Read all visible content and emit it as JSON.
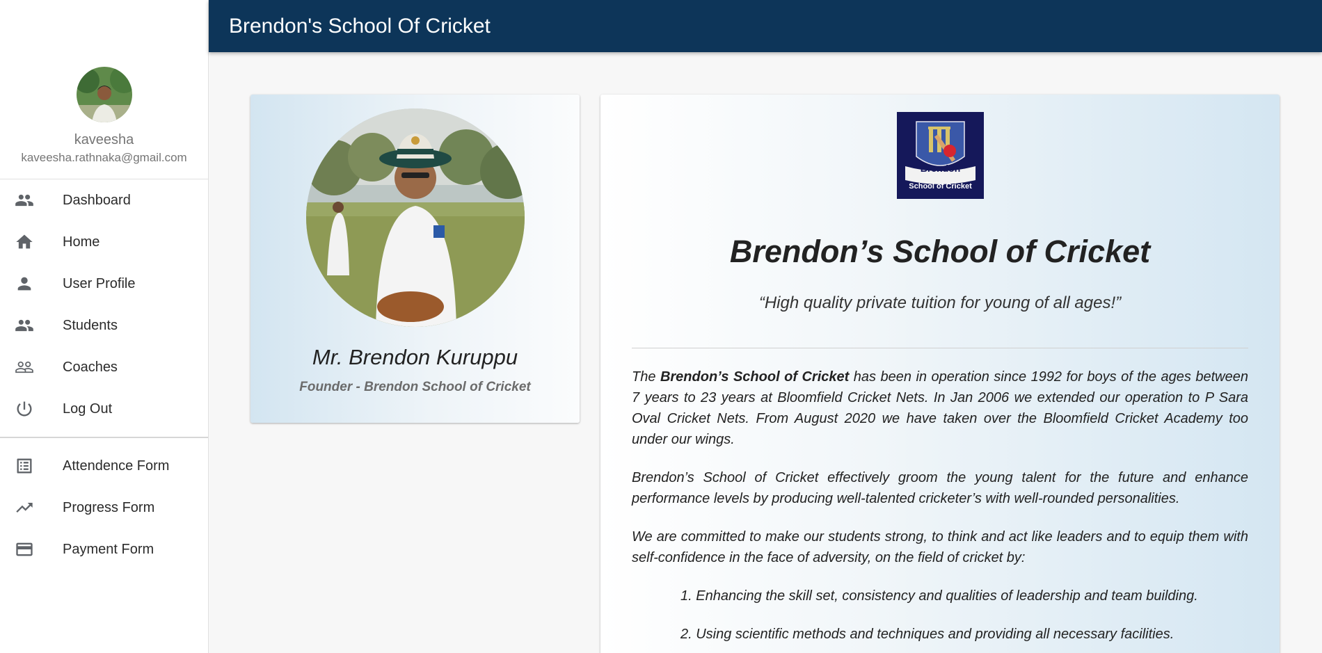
{
  "app": {
    "title": "Brendon's School Of Cricket"
  },
  "user": {
    "name": "kaveesha",
    "email": "kaveesha.rathnaka@gmail.com"
  },
  "nav": {
    "primary": [
      {
        "label": "Dashboard",
        "icon": "people-icon"
      },
      {
        "label": "Home",
        "icon": "home-icon"
      },
      {
        "label": "User Profile",
        "icon": "person-icon"
      },
      {
        "label": "Students",
        "icon": "people-icon"
      },
      {
        "label": "Coaches",
        "icon": "people-outline-icon"
      },
      {
        "label": "Log Out",
        "icon": "power-icon"
      }
    ],
    "secondary": [
      {
        "label": "Attendence Form",
        "icon": "list-icon"
      },
      {
        "label": "Progress Form",
        "icon": "trending-up-icon"
      },
      {
        "label": "Payment Form",
        "icon": "credit-card-icon"
      }
    ]
  },
  "founder": {
    "name": "Mr. Brendon Kuruppu",
    "role": "Founder - Brendon School of Cricket"
  },
  "logo": {
    "line1": "Brendon",
    "line2": "School of Cricket"
  },
  "about": {
    "title": "Brendon’s School of Cricket",
    "tagline": "“High quality private tuition for young of all ages!”",
    "p1_pre": "The ",
    "p1_bold": "Brendon’s School of Cricket",
    "p1_post": " has been in operation since 1992 for boys of the ages between 7 years to 23 years at Bloomfield Cricket Nets. In Jan 2006 we extended our operation to P Sara Oval Cricket Nets. From August 2020 we have taken over the Bloomfield Cricket Academy too under our wings.",
    "p2": "Brendon’s School of Cricket effectively groom the young talent for the future and enhance performance levels by producing well-talented cricketer’s with well-rounded personalities.",
    "p3": "We are committed to make our students strong, to think and act like leaders and to equip them with self-confidence in the face of adversity, on the field of cricket by:",
    "list": [
      "1. Enhancing the skill set, consistency and qualities of leadership and team building.",
      "2. Using scientific methods and techniques and providing all necessary facilities."
    ]
  },
  "colors": {
    "appbar": "#0d3559",
    "logo_bg": "#15185a",
    "accent_red": "#d8262f"
  }
}
